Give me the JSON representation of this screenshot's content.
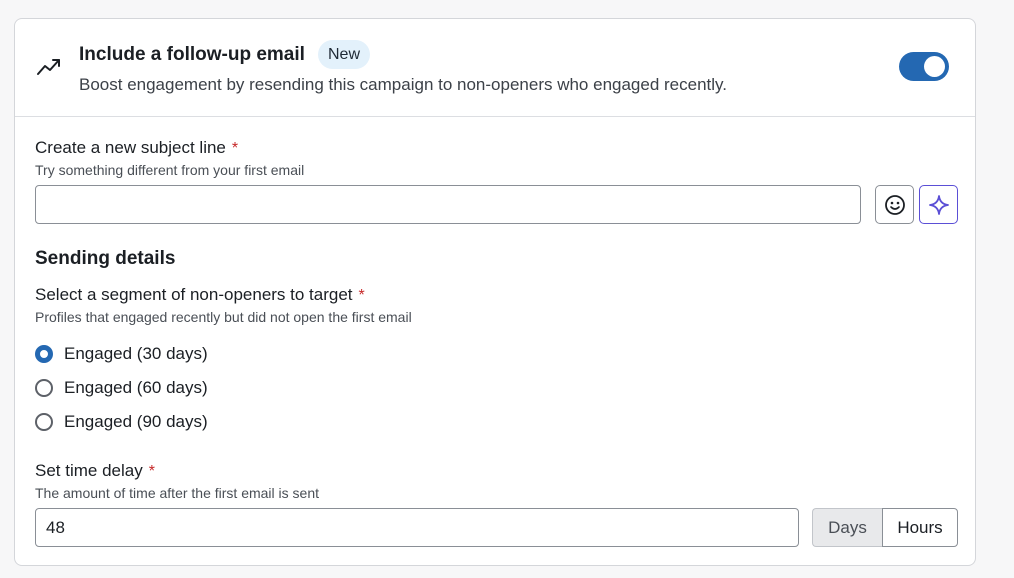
{
  "header": {
    "title": "Include a follow-up email",
    "badge": "New",
    "subtitle": "Boost engagement by resending this campaign to non-openers who engaged recently.",
    "toggle_on": true,
    "icon": "trending-up-icon"
  },
  "subject": {
    "label": "Create a new subject line",
    "required_mark": "*",
    "hint": "Try something different from your first email",
    "value": "",
    "emoji_icon": "smiley-icon",
    "ai_icon": "sparkle-icon"
  },
  "sending": {
    "title": "Sending details",
    "segment_label": "Select a segment of non-openers to target",
    "segment_required": "*",
    "segment_hint": "Profiles that engaged recently but did not open the first email",
    "options": [
      {
        "label": "Engaged (30 days)",
        "checked": true
      },
      {
        "label": "Engaged (60 days)",
        "checked": false
      },
      {
        "label": "Engaged (90 days)",
        "checked": false
      }
    ],
    "delay_label": "Set time delay",
    "delay_required": "*",
    "delay_hint": "The amount of time after the first email is sent",
    "delay_value": "48",
    "units": {
      "days": "Days",
      "hours": "Hours",
      "selected": "Hours"
    }
  },
  "colors": {
    "accent": "#2468b2",
    "required": "#c62828",
    "ai": "#5b4fd6",
    "badge_bg": "#e3f1fb"
  }
}
